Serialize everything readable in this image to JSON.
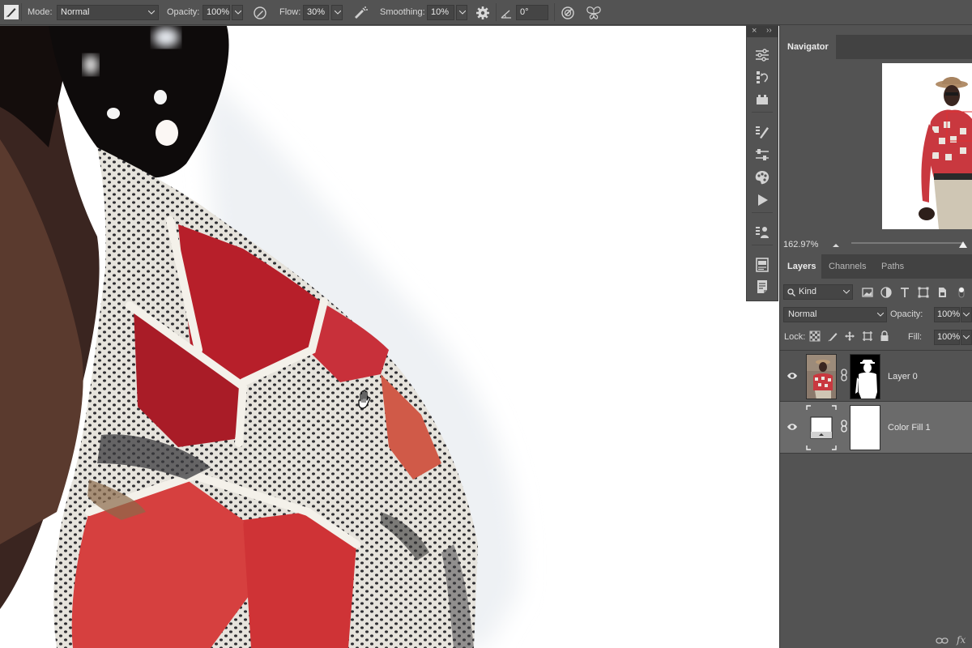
{
  "options_bar": {
    "mode_label": "Mode:",
    "mode_value": "Normal",
    "opacity_label": "Opacity:",
    "opacity_value": "100%",
    "flow_label": "Flow:",
    "flow_value": "30%",
    "smoothing_label": "Smoothing:",
    "smoothing_value": "10%",
    "angle_value": "0°"
  },
  "navigator": {
    "tab_label": "Navigator",
    "zoom": "162.97%"
  },
  "layers_panel": {
    "tabs": [
      "Layers",
      "Channels",
      "Paths"
    ],
    "filter_kind": "Kind",
    "blend_mode": "Normal",
    "opacity_label": "Opacity:",
    "opacity_value": "100%",
    "lock_label": "Lock:",
    "fill_label": "Fill:",
    "fill_value": "100%",
    "layers": [
      {
        "name": "Layer 0"
      },
      {
        "name": "Color Fill 1"
      }
    ],
    "footer_fx": "fx"
  },
  "colors": {
    "ui_bg": "#535353",
    "panel_dark": "#424242",
    "field_bg": "#454545",
    "selected_row": "#6b6b6b",
    "shirt_red": "#c4262b",
    "nav_marker": "#e03030"
  },
  "icons": {
    "tool": "brush-tool-icon",
    "pressure_opacity": "pressure-opacity-icon",
    "airbrush": "airbrush-icon",
    "smoothing_settings": "gear-icon",
    "angle": "angle-icon",
    "pressure_size": "pressure-size-icon",
    "symmetry": "butterfly-symmetry-icon",
    "cursor": "hand-cursor-icon"
  }
}
